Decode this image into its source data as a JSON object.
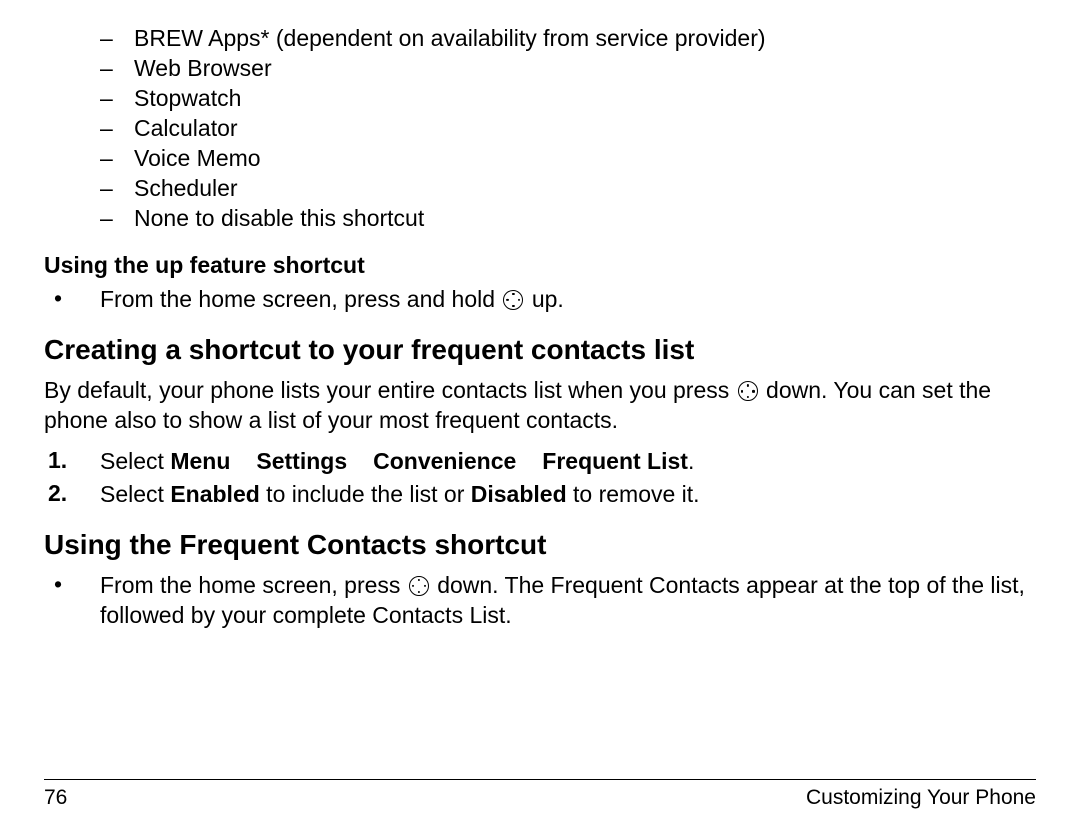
{
  "dash_items": [
    "BREW Apps* (dependent on availability from service provider)",
    "Web Browser",
    "Stopwatch",
    "Calculator",
    "Voice Memo",
    "Scheduler",
    "None to disable this shortcut"
  ],
  "subhead1": "Using the up feature shortcut",
  "bullet1_pre": "From the home screen, press and hold ",
  "bullet1_post": " up.",
  "h2a": "Creating a shortcut to your frequent contacts list",
  "para_a_pre": "By default, your phone lists your entire contacts list when you press ",
  "para_a_post": " down. You can set the phone also to show a list of your most frequent contacts.",
  "steps": [
    {
      "num": "1.",
      "pre": "Select ",
      "menu_path": [
        "Menu",
        "Settings",
        "Convenience",
        "Frequent List"
      ],
      "post": "."
    },
    {
      "num": "2.",
      "pre": "Select ",
      "bold1": "Enabled",
      "mid": " to include the list or ",
      "bold2": "Disabled",
      "post": " to remove it."
    }
  ],
  "h2b": "Using the Frequent Contacts shortcut",
  "bullet2_pre": "From the home screen, press ",
  "bullet2_post": " down. The Frequent Contacts appear at the top of the list, followed by your complete Contacts List.",
  "footer": {
    "page": "76",
    "section": "Customizing Your Phone"
  }
}
